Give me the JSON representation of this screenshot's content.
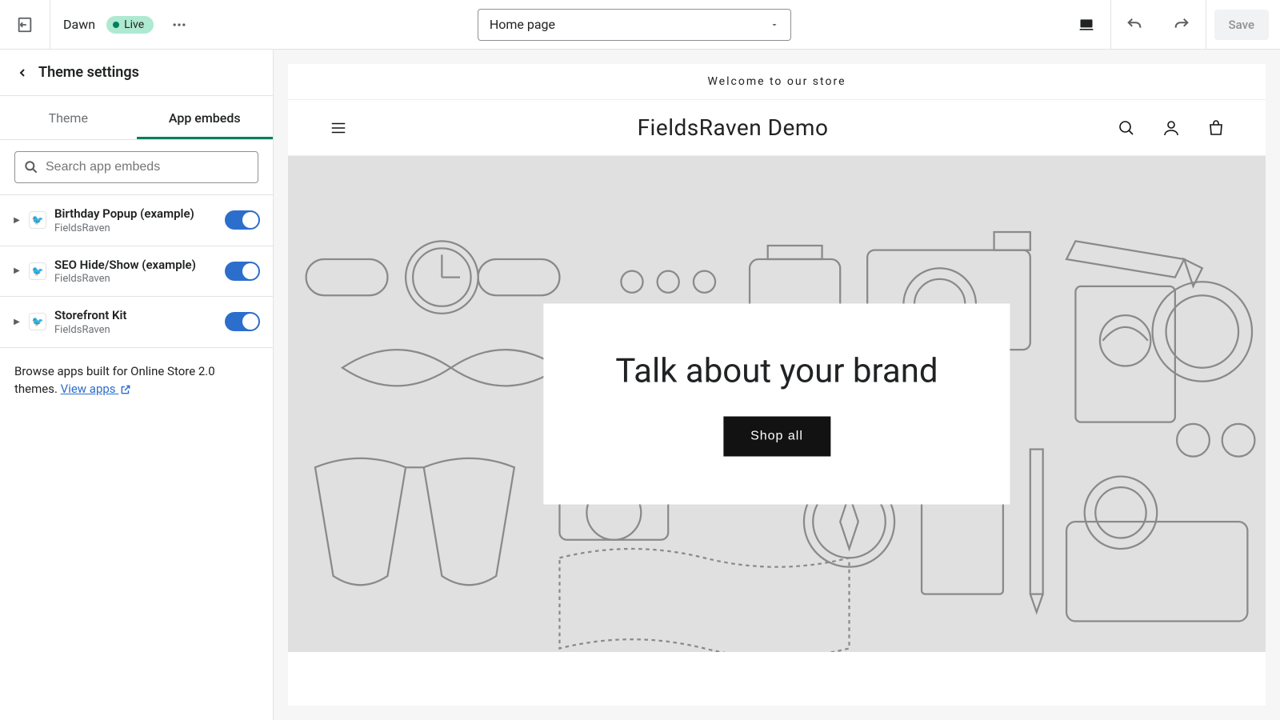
{
  "topbar": {
    "theme_name": "Dawn",
    "live_label": "Live",
    "page_select": "Home page",
    "save_label": "Save"
  },
  "sidebar": {
    "title": "Theme settings",
    "tabs": {
      "theme": "Theme",
      "embeds": "App embeds"
    },
    "search_placeholder": "Search app embeds",
    "embeds": [
      {
        "title": "Birthday Popup (example)",
        "sub": "FieldsRaven",
        "on": true
      },
      {
        "title": "SEO Hide/Show (example)",
        "sub": "FieldsRaven",
        "on": true
      },
      {
        "title": "Storefront Kit",
        "sub": "FieldsRaven",
        "on": true
      }
    ],
    "hint_text": "Browse apps built for Online Store 2.0 themes. ",
    "hint_link": "View apps"
  },
  "preview": {
    "announcement": "Welcome to our store",
    "store_name": "FieldsRaven Demo",
    "hero_heading": "Talk about your brand",
    "hero_button": "Shop all"
  }
}
